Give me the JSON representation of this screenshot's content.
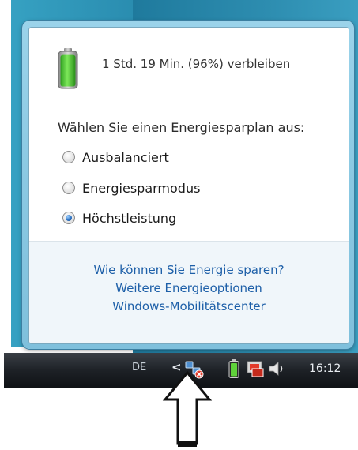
{
  "popup": {
    "battery_status": "1 Std. 19 Min. (96%) verbleiben",
    "battery_percent": 96,
    "plan_prompt": "Wählen Sie einen Energiesparplan aus:",
    "plans": [
      {
        "label": "Ausbalanciert",
        "selected": false
      },
      {
        "label": "Energiesparmodus",
        "selected": false
      },
      {
        "label": "Höchstleistung",
        "selected": true
      }
    ],
    "links": [
      "Wie können Sie Energie sparen?",
      "Weitere Energieoptionen",
      "Windows-Mobilitätscenter"
    ]
  },
  "taskbar": {
    "language": "DE",
    "show_hidden": "<",
    "clock": "16:12",
    "tray_icons": [
      "network-icon",
      "battery-icon",
      "safely-remove-icon",
      "volume-icon"
    ]
  },
  "colors": {
    "link": "#1d5fa8",
    "battery_fill": "#3fbf2c",
    "radio_selected": "#2a6fc0"
  }
}
